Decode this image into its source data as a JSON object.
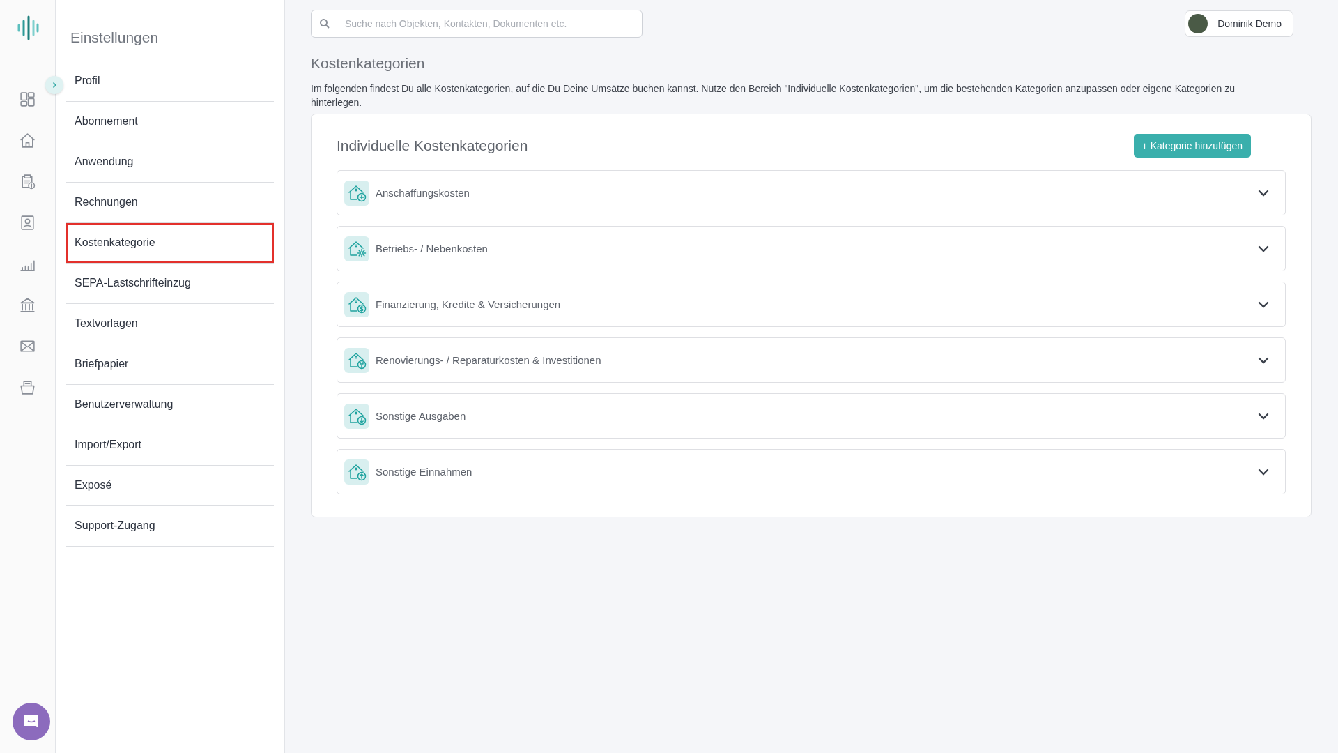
{
  "settings": {
    "title": "Einstellungen",
    "items": [
      {
        "label": "Profil",
        "selected": false
      },
      {
        "label": "Abonnement",
        "selected": false
      },
      {
        "label": "Anwendung",
        "selected": false
      },
      {
        "label": "Rechnungen",
        "selected": false
      },
      {
        "label": "Kostenkategorie",
        "selected": true
      },
      {
        "label": "SEPA-Lastschrifteinzug",
        "selected": false
      },
      {
        "label": "Textvorlagen",
        "selected": false
      },
      {
        "label": "Briefpapier",
        "selected": false
      },
      {
        "label": "Benutzerverwaltung",
        "selected": false
      },
      {
        "label": "Import/Export",
        "selected": false
      },
      {
        "label": "Exposé",
        "selected": false
      },
      {
        "label": "Support-Zugang",
        "selected": false
      }
    ]
  },
  "search": {
    "placeholder": "Suche nach Objekten, Kontakten, Dokumenten etc."
  },
  "user": {
    "name": "Dominik Demo"
  },
  "page": {
    "title": "Kostenkategorien",
    "description": "Im folgenden findest Du alle Kostenkategorien, auf die Du Deine Umsätze buchen kannst. Nutze den Bereich \"Individuelle Kostenkategorien\", um die bestehenden Kategorien anzupassen oder eigene Kategorien zu hinterlegen."
  },
  "card": {
    "title": "Individuelle Kostenkategorien",
    "add_button": "+ Kategorie hinzufügen",
    "categories": [
      {
        "label": "Anschaffungskosten",
        "kind": "plus",
        "expanded": false
      },
      {
        "label": "Betriebs- / Nebenkosten",
        "kind": "gear",
        "expanded": false
      },
      {
        "label": "Finanzierung, Kredite & Versicherungen",
        "kind": "dollar",
        "expanded": false
      },
      {
        "label": "Renovierungs- / Reparaturkosten & Investitionen",
        "kind": "wrench",
        "expanded": false
      },
      {
        "label": "Sonstige Ausgaben",
        "kind": "down",
        "expanded": false
      },
      {
        "label": "Sonstige Einnahmen",
        "kind": "up",
        "expanded": false
      }
    ]
  }
}
